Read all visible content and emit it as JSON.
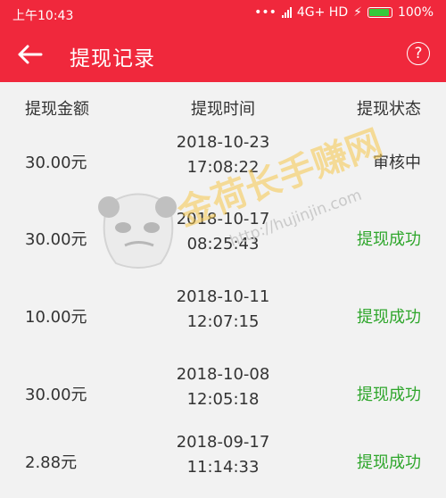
{
  "status_bar": {
    "time": "上午10:43",
    "network": "4G+ HD",
    "battery": "100%",
    "battery_level": 1.0
  },
  "app_bar": {
    "title": "提现记录",
    "back_icon": "arrow-left-icon",
    "help_icon": "?"
  },
  "table": {
    "headers": [
      "提现金额",
      "提现时间",
      "提现状态"
    ],
    "rows": [
      {
        "amount": "30.00元",
        "date": "2018-10-23",
        "time": "17:08:22",
        "status": "审核中"
      },
      {
        "amount": "30.00元",
        "date": "2018-10-17",
        "time": "08:25:43",
        "status": "提现成功"
      },
      {
        "amount": "10.00元",
        "date": "2018-10-11",
        "time": "12:07:15",
        "status": "提现成功"
      },
      {
        "amount": "30.00元",
        "date": "2018-10-08",
        "time": "12:05:18",
        "status": "提现成功"
      },
      {
        "amount": "2.88元",
        "date": "2018-09-17",
        "time": "11:14:33",
        "status": "提现成功"
      }
    ]
  },
  "watermark": {
    "text": "金荷长手赚网",
    "url": "http://hujinjin.com"
  },
  "colors": {
    "brand": "#f0283c",
    "success": "#2fa62c",
    "background": "#f2f2f2"
  }
}
